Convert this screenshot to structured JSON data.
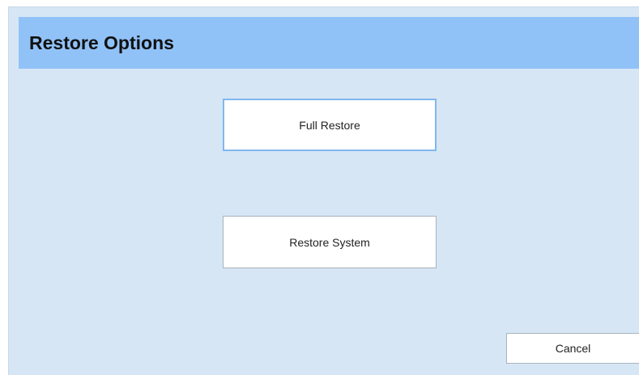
{
  "dialog": {
    "title": "Restore Options"
  },
  "buttons": {
    "full_restore": "Full Restore",
    "restore_system": "Restore System",
    "cancel": "Cancel"
  },
  "colors": {
    "background": "#d6e6f5",
    "title_bar": "#90c2f7",
    "button_bg": "#ffffff",
    "focus_border": "#80b7ee"
  }
}
